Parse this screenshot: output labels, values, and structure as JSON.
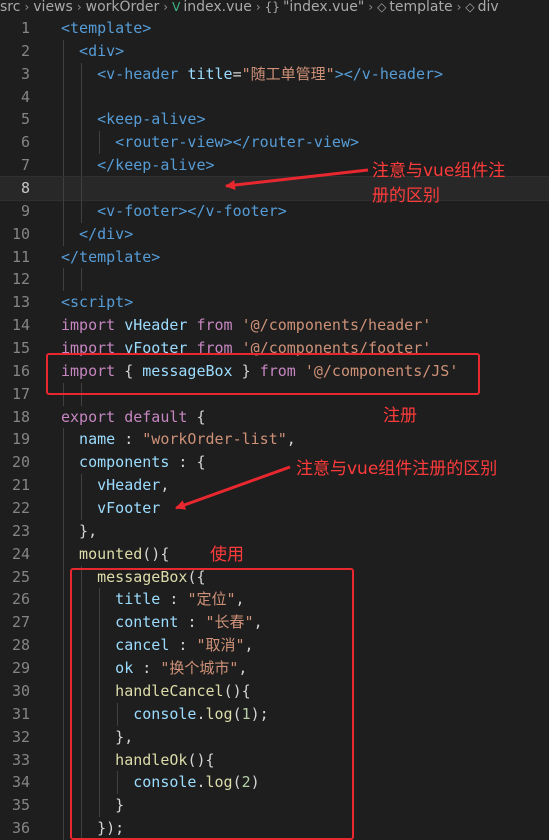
{
  "breadcrumb": {
    "items": [
      "src",
      "views",
      "workOrder",
      "index.vue",
      "\"index.vue\"",
      "template",
      "div"
    ],
    "icons": [
      "vue-icon",
      "braces-icon",
      "cube-icon",
      "cube-icon"
    ]
  },
  "lines": [
    {
      "n": "1",
      "tokens": [
        [
          "tag",
          "<template>"
        ]
      ]
    },
    {
      "n": "2",
      "tokens": [
        [
          "tag",
          "  <div>"
        ]
      ]
    },
    {
      "n": "3",
      "tokens": [
        [
          "tag",
          "    <v-header "
        ],
        [
          "attr",
          "title"
        ],
        [
          "plain",
          "="
        ],
        [
          "str",
          "\"随工单管理\""
        ],
        [
          "tag",
          "></v-header>"
        ]
      ]
    },
    {
      "n": "4",
      "tokens": []
    },
    {
      "n": "5",
      "tokens": [
        [
          "tag",
          "    <keep-alive>"
        ]
      ]
    },
    {
      "n": "6",
      "tokens": [
        [
          "tag",
          "      <router-view></router-view>"
        ]
      ]
    },
    {
      "n": "7",
      "tokens": [
        [
          "tag",
          "    </keep-alive>"
        ]
      ]
    },
    {
      "n": "8",
      "tokens": []
    },
    {
      "n": "9",
      "tokens": [
        [
          "tag",
          "    <v-footer></v-footer>"
        ]
      ]
    },
    {
      "n": "10",
      "tokens": [
        [
          "tag",
          "  </div>"
        ]
      ]
    },
    {
      "n": "11",
      "tokens": [
        [
          "tag",
          "</template>"
        ]
      ]
    },
    {
      "n": "12",
      "tokens": []
    },
    {
      "n": "13",
      "tokens": [
        [
          "tag",
          "<script>"
        ]
      ]
    },
    {
      "n": "14",
      "tokens": [
        [
          "kw",
          "import "
        ],
        [
          "prop",
          "vHeader "
        ],
        [
          "kw",
          "from "
        ],
        [
          "str",
          "'@/components/header'"
        ]
      ]
    },
    {
      "n": "15",
      "tokens": [
        [
          "kw",
          "import "
        ],
        [
          "prop",
          "vFooter "
        ],
        [
          "kw",
          "from "
        ],
        [
          "str",
          "'@/components/footer'"
        ]
      ]
    },
    {
      "n": "16",
      "tokens": [
        [
          "kw",
          "import "
        ],
        [
          "plain",
          "{ "
        ],
        [
          "prop",
          "messageBox "
        ],
        [
          "plain",
          "} "
        ],
        [
          "kw",
          "from "
        ],
        [
          "str",
          "'@/components/JS'"
        ]
      ]
    },
    {
      "n": "17",
      "tokens": []
    },
    {
      "n": "18",
      "tokens": [
        [
          "kw",
          "export "
        ],
        [
          "kw",
          "default "
        ],
        [
          "plain",
          "{"
        ]
      ]
    },
    {
      "n": "19",
      "tokens": [
        [
          "prop",
          "  name "
        ],
        [
          "plain",
          ": "
        ],
        [
          "str",
          "\"workOrder-list\""
        ],
        [
          "plain",
          ","
        ]
      ]
    },
    {
      "n": "20",
      "tokens": [
        [
          "prop",
          "  components "
        ],
        [
          "plain",
          ": {"
        ]
      ]
    },
    {
      "n": "21",
      "tokens": [
        [
          "prop",
          "    vHeader"
        ],
        [
          "plain",
          ","
        ]
      ]
    },
    {
      "n": "22",
      "tokens": [
        [
          "prop",
          "    vFooter"
        ]
      ]
    },
    {
      "n": "23",
      "tokens": [
        [
          "plain",
          "  },"
        ]
      ]
    },
    {
      "n": "24",
      "tokens": [
        [
          "fn",
          "  mounted"
        ],
        [
          "plain",
          "(){"
        ]
      ]
    },
    {
      "n": "25",
      "tokens": [
        [
          "fn",
          "    messageBox"
        ],
        [
          "plain",
          "({"
        ]
      ]
    },
    {
      "n": "26",
      "tokens": [
        [
          "prop",
          "      title "
        ],
        [
          "plain",
          ": "
        ],
        [
          "str",
          "\"定位\""
        ],
        [
          "plain",
          ","
        ]
      ]
    },
    {
      "n": "27",
      "tokens": [
        [
          "prop",
          "      content "
        ],
        [
          "plain",
          ": "
        ],
        [
          "str",
          "\"长春\""
        ],
        [
          "plain",
          ","
        ]
      ]
    },
    {
      "n": "28",
      "tokens": [
        [
          "prop",
          "      cancel "
        ],
        [
          "plain",
          ": "
        ],
        [
          "str",
          "\"取消\""
        ],
        [
          "plain",
          ","
        ]
      ]
    },
    {
      "n": "29",
      "tokens": [
        [
          "prop",
          "      ok "
        ],
        [
          "plain",
          ": "
        ],
        [
          "str",
          "\"换个城市\""
        ],
        [
          "plain",
          ","
        ]
      ]
    },
    {
      "n": "30",
      "tokens": [
        [
          "fn",
          "      handleCancel"
        ],
        [
          "plain",
          "(){"
        ]
      ]
    },
    {
      "n": "31",
      "tokens": [
        [
          "prop",
          "        console"
        ],
        [
          "plain",
          "."
        ],
        [
          "fn",
          "log"
        ],
        [
          "plain",
          "("
        ],
        [
          "num",
          "1"
        ],
        [
          "plain",
          ");"
        ]
      ]
    },
    {
      "n": "32",
      "tokens": [
        [
          "plain",
          "      },"
        ]
      ]
    },
    {
      "n": "33",
      "tokens": [
        [
          "fn",
          "      handleOk"
        ],
        [
          "plain",
          "(){"
        ]
      ]
    },
    {
      "n": "34",
      "tokens": [
        [
          "prop",
          "        console"
        ],
        [
          "plain",
          "."
        ],
        [
          "fn",
          "log"
        ],
        [
          "plain",
          "("
        ],
        [
          "num",
          "2"
        ],
        [
          "plain",
          ")"
        ]
      ]
    },
    {
      "n": "35",
      "tokens": [
        [
          "plain",
          "      }"
        ]
      ]
    },
    {
      "n": "36",
      "tokens": [
        [
          "plain",
          "    });"
        ]
      ]
    }
  ],
  "annotations": {
    "note_top": "注意与vue组件注\n册的区别",
    "note_register": "注册",
    "note_components": "注意与vue组件注册的区别",
    "note_use": "使用"
  },
  "colors": {
    "background": "#1e1e1e",
    "annotation_red": "#e8272f",
    "tag": "#569cd6",
    "string": "#ce9178",
    "keyword": "#c586c0",
    "property": "#9cdcfe",
    "function": "#dcdcaa"
  }
}
